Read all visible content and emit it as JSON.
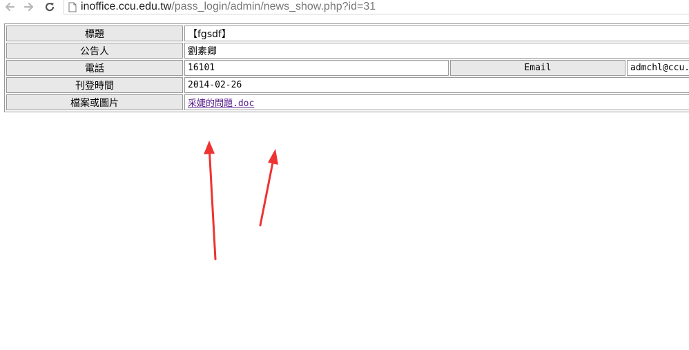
{
  "browser": {
    "url_host": "inoffice.ccu.edu.tw",
    "url_path": "/pass_login/admin/news_show.php?id=31"
  },
  "table": {
    "title_label": "標題",
    "title_value": "【fgsdf】",
    "publisher_label": "公告人",
    "publisher_value": "劉素卿",
    "phone_label": "電話",
    "phone_value": "16101",
    "email_label": "Email",
    "email_value": "admchl@ccu.e",
    "date_label": "刊登時間",
    "date_value": "2014-02-26",
    "file_label": "檔案或圖片",
    "file_value": "采婕的問題.doc"
  },
  "colors": {
    "label_bg": "#e8e8e8",
    "link_visited": "#551a8b",
    "arrow": "#ee3333"
  },
  "icons": [
    "back-arrow-icon",
    "forward-arrow-icon",
    "reload-icon",
    "page-icon"
  ]
}
